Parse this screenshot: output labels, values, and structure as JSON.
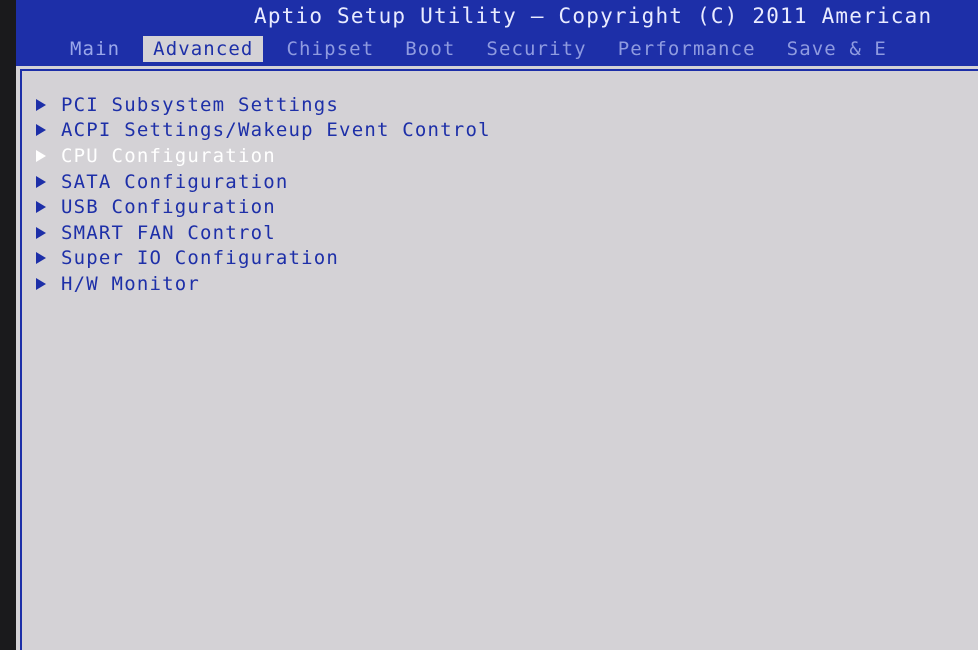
{
  "header": {
    "title": "Aptio Setup Utility – Copyright (C) 2011 American"
  },
  "tabs": [
    {
      "label": "Main"
    },
    {
      "label": "Advanced"
    },
    {
      "label": "Chipset"
    },
    {
      "label": "Boot"
    },
    {
      "label": "Security"
    },
    {
      "label": "Performance"
    },
    {
      "label": "Save & E"
    }
  ],
  "active_tab": "Advanced",
  "menu": {
    "selected": "CPU Configuration",
    "items": [
      {
        "label": "PCI Subsystem Settings",
        "icon": "triangle-right-icon"
      },
      {
        "label": "ACPI Settings/Wakeup Event Control",
        "icon": "triangle-right-icon"
      },
      {
        "label": "CPU Configuration",
        "icon": "triangle-right-icon"
      },
      {
        "label": "SATA Configuration",
        "icon": "triangle-right-icon"
      },
      {
        "label": "USB Configuration",
        "icon": "triangle-right-icon"
      },
      {
        "label": "SMART FAN Control",
        "icon": "triangle-right-icon"
      },
      {
        "label": "Super IO Configuration",
        "icon": "triangle-right-icon"
      },
      {
        "label": "H/W Monitor",
        "icon": "triangle-right-icon"
      }
    ]
  },
  "colors": {
    "header_background": "#1d2fa8",
    "panel_background": "#d4d2d6",
    "menu_text": "#1d2fa8",
    "selected_text": "#ffffff",
    "inactive_tab_text": "#8f9be0"
  }
}
